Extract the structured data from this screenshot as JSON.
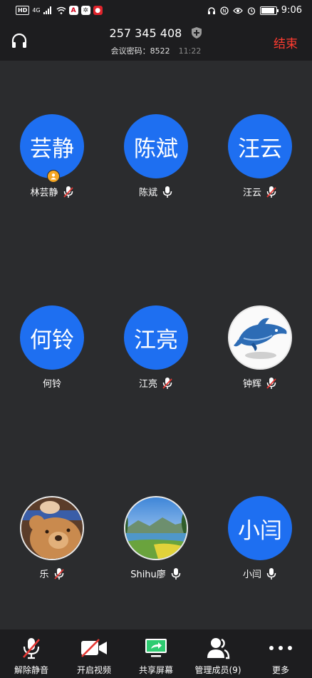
{
  "status_bar": {
    "hd": "HD",
    "network": "4G",
    "time": "9:06"
  },
  "header": {
    "meeting_id": "257 345 408",
    "password_label": "会议密码：",
    "password": "8522",
    "elapsed": "11:22",
    "end_label": "结束"
  },
  "participants": [
    {
      "avatar_text": "芸静",
      "name": "林芸静",
      "mic": "muted",
      "host": true
    },
    {
      "avatar_text": "陈斌",
      "name": "陈斌",
      "mic": "on"
    },
    {
      "avatar_text": "汪云",
      "name": "汪云",
      "mic": "muted"
    },
    {
      "avatar_text": "何铃",
      "name": "何铃",
      "mic": "none"
    },
    {
      "avatar_text": "江亮",
      "name": "江亮",
      "mic": "muted"
    },
    {
      "avatar_text": "",
      "name": "钟辉",
      "mic": "muted",
      "avatar_image": "dolphin"
    },
    {
      "avatar_text": "",
      "name": "乐",
      "mic": "muted",
      "avatar_image": "teddy-bear"
    },
    {
      "avatar_text": "",
      "name": "Shihu廖",
      "mic": "on",
      "avatar_image": "lake-landscape"
    },
    {
      "avatar_text": "小闫",
      "name": "小闫",
      "mic": "on"
    }
  ],
  "toolbar": {
    "unmute": "解除静音",
    "video": "开启视频",
    "share": "共享屏幕",
    "members": "管理成员(9)",
    "more": "更多"
  },
  "colors": {
    "avatar_blue": "#1e6ff1",
    "end_red": "#ff3b30",
    "share_green": "#2ecc71",
    "host_badge": "#f5a623"
  }
}
